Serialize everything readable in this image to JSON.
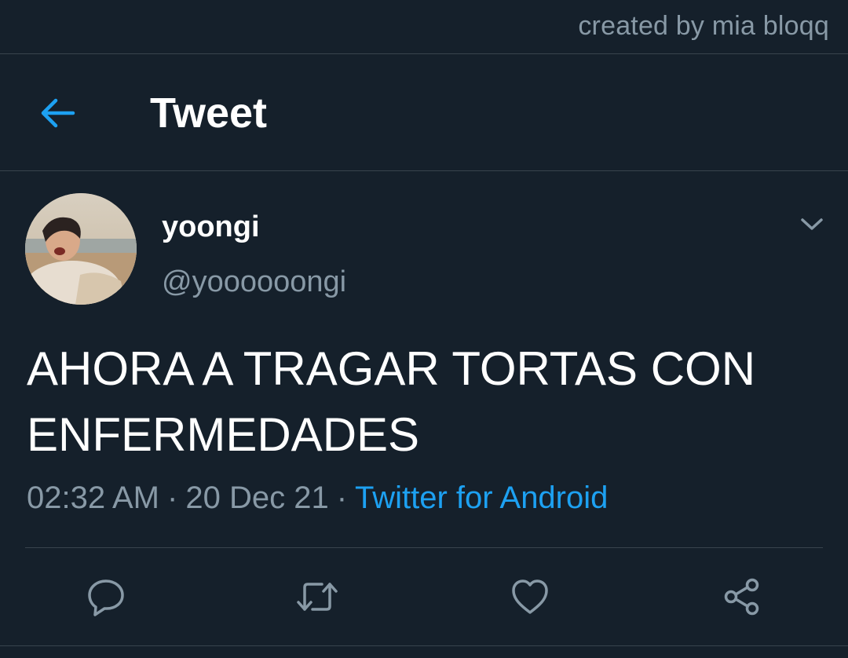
{
  "watermark": "created by mia bloqq",
  "header": {
    "title": "Tweet",
    "back_icon": "back-arrow-icon"
  },
  "tweet": {
    "author": {
      "display_name": "yoongi",
      "handle": "@yoooooongi"
    },
    "text": "AHORA A TRAGAR TORTAS CON ENFERMEDADES",
    "time": "02:32 AM",
    "date": "20 Dec 21",
    "separator": "·",
    "source": "Twitter for Android"
  },
  "actions": [
    "reply-icon",
    "retweet-icon",
    "like-icon",
    "share-icon"
  ],
  "colors": {
    "background": "#15202b",
    "accent": "#1da1f2",
    "secondary_text": "#8899a6",
    "divider": "#38444d"
  }
}
